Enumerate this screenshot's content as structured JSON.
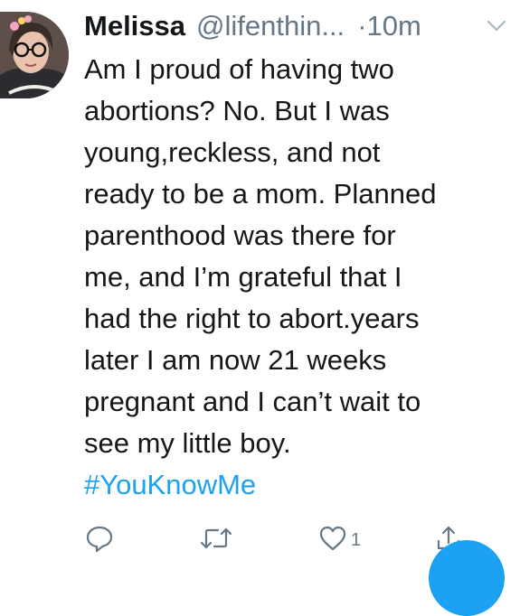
{
  "tweet": {
    "author_name": "Melissa",
    "author_handle": "@lifenthin...",
    "time_separator": "·",
    "time": "10m",
    "body_lines": [
      "Am I proud of having two",
      "abortions? No. But I was",
      "young,reckless, and not",
      "ready to be a mom. Planned",
      "parenthood was there for",
      "me, and I’m grateful that I",
      "had the right to abort.years",
      "later I am now 21 weeks",
      "pregnant and I can’t wait to",
      "see my little boy."
    ],
    "hashtag": "#YouKnowMe",
    "like_count": "1"
  },
  "icons": {
    "menu": "chevron-down-icon",
    "reply": "reply-icon",
    "retweet": "retweet-icon",
    "like": "heart-icon",
    "share": "share-icon",
    "compose": "compose-button"
  },
  "colors": {
    "accent": "#1da1f2",
    "muted": "#657786",
    "text": "#14171a"
  }
}
